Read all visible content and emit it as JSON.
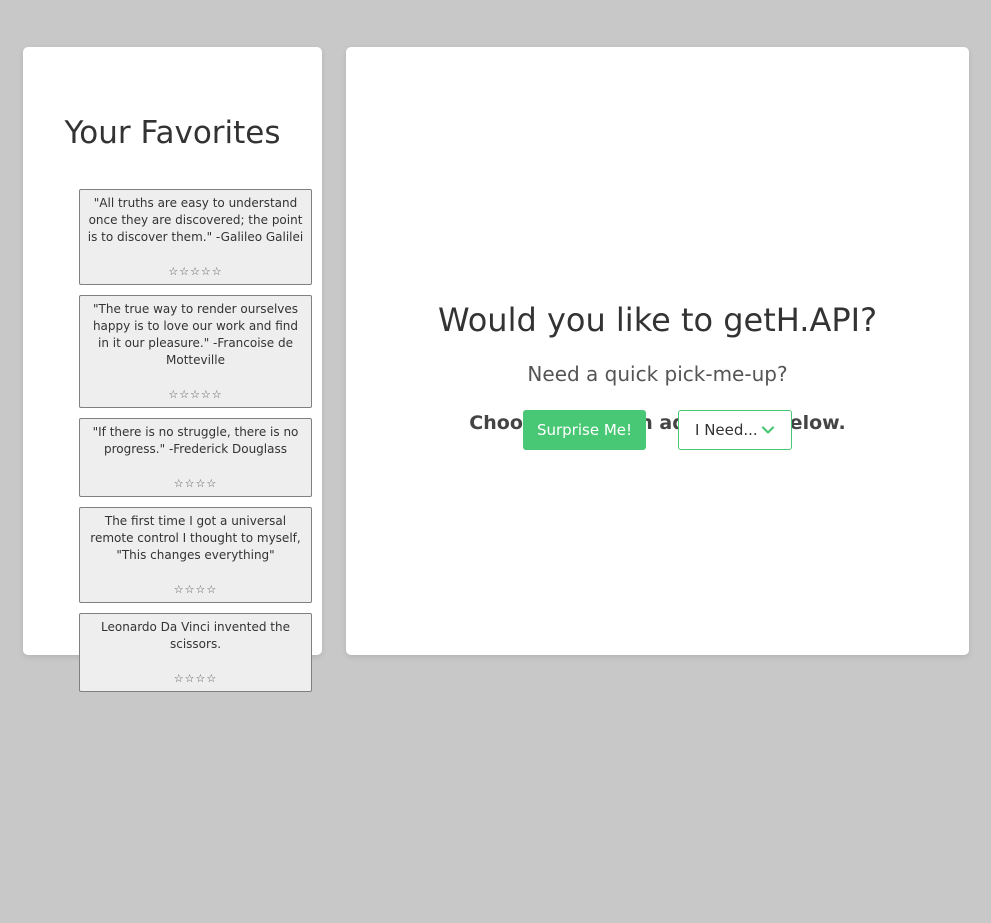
{
  "favorites": {
    "title": "Your Favorites",
    "items": [
      {
        "quote": "\"All truths are easy to understand once they are discovered; the point is to discover them.\" -Galileo Galilei",
        "stars": "☆☆☆☆☆"
      },
      {
        "quote": "\"The true way to render ourselves happy is to love our work and find in it our pleasure.\" -Francoise de Motteville",
        "stars": "☆☆☆☆☆"
      },
      {
        "quote": "\"If there is no struggle, there is no progress.\" -Frederick Douglass",
        "stars": "☆☆☆☆"
      },
      {
        "quote": "The first time I got a universal remote control I thought to myself, \"This changes everything\"",
        "stars": "☆☆☆☆"
      },
      {
        "quote": "Leonardo Da Vinci invented the scissors.",
        "stars": "☆☆☆☆"
      }
    ]
  },
  "main": {
    "title": "Would you like to getH.API?",
    "subtitle": "Need a quick pick-me-up?",
    "cta": "Choose your own adventure below.",
    "surprise_label": "Surprise Me!",
    "dropdown_label": "I Need...",
    "dropdown_icon": "chevron-down-icon"
  },
  "colors": {
    "accent": "#48c774",
    "background": "#c8c8c8",
    "card_background": "#eeeeee"
  }
}
